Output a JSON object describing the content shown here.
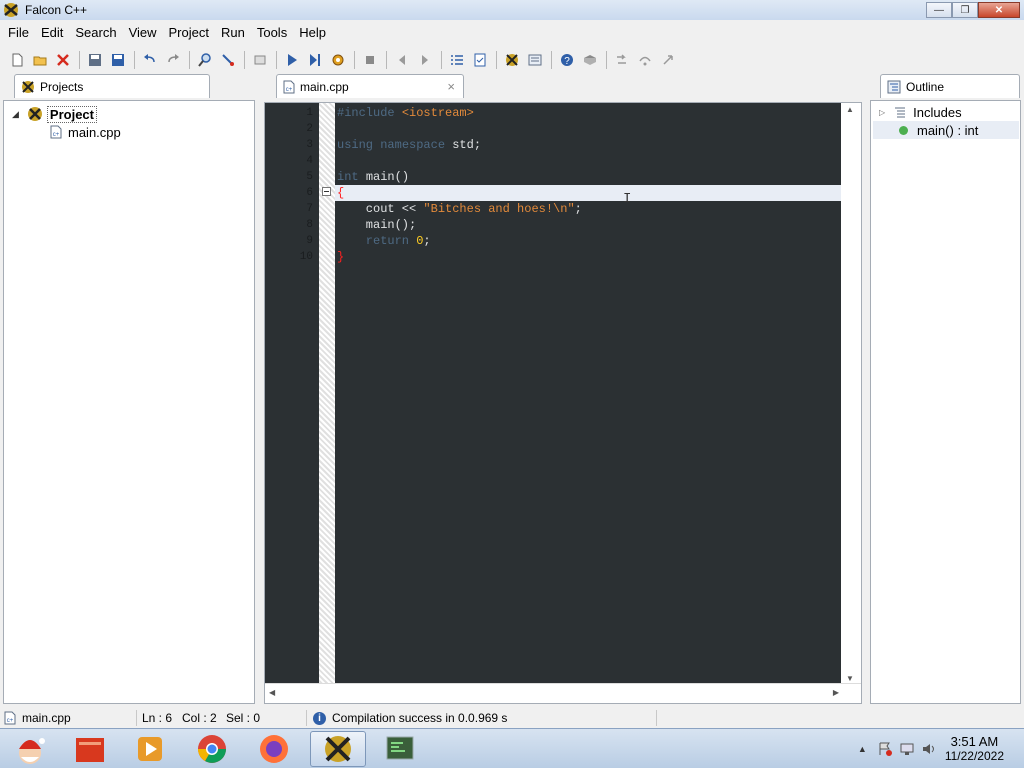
{
  "window": {
    "title": "Falcon C++"
  },
  "menu": [
    "File",
    "Edit",
    "Search",
    "View",
    "Project",
    "Run",
    "Tools",
    "Help"
  ],
  "toolbar": {
    "buttons": [
      "new-file",
      "open",
      "close",
      "save",
      "save-all",
      "undo",
      "redo",
      "find",
      "replace",
      "toggle-comment",
      "run",
      "build-run",
      "compile",
      "stop",
      "prev",
      "next",
      "list",
      "properties",
      "falcon",
      "packages",
      "help",
      "book",
      "step-into",
      "step-over",
      "step-out"
    ]
  },
  "projects_panel": {
    "tab_label": "Projects",
    "root": "Project",
    "files": [
      "main.cpp"
    ]
  },
  "editor": {
    "tab_label": "main.cpp",
    "close_glyph": "×",
    "line_numbers": [
      "1",
      "2",
      "3",
      "4",
      "5",
      "6",
      "7",
      "8",
      "9",
      "10"
    ],
    "lines": [
      {
        "parts": [
          {
            "t": "#include ",
            "c": "kw"
          },
          {
            "t": "<iostream>",
            "c": "str"
          }
        ]
      },
      {
        "parts": []
      },
      {
        "parts": [
          {
            "t": "using ",
            "c": "kw"
          },
          {
            "t": "namespace ",
            "c": "kw"
          },
          {
            "t": "std;",
            "c": ""
          }
        ]
      },
      {
        "parts": []
      },
      {
        "parts": [
          {
            "t": "int ",
            "c": "kw"
          },
          {
            "t": "main()",
            "c": ""
          }
        ]
      },
      {
        "parts": [
          {
            "t": "{",
            "c": "brace-red"
          }
        ]
      },
      {
        "parts": [
          {
            "t": "    cout << ",
            "c": ""
          },
          {
            "t": "\"Bitches and hoes!\\n\"",
            "c": "str"
          },
          {
            "t": ";",
            "c": ""
          }
        ]
      },
      {
        "parts": [
          {
            "t": "    main();",
            "c": ""
          }
        ]
      },
      {
        "parts": [
          {
            "t": "    return ",
            "c": "kw"
          },
          {
            "t": "0",
            "c": "num"
          },
          {
            "t": ";",
            "c": ""
          }
        ]
      },
      {
        "parts": [
          {
            "t": "}",
            "c": "brace-red"
          }
        ]
      }
    ]
  },
  "outline_panel": {
    "tab_label": "Outline",
    "items": [
      {
        "label": "Includes"
      },
      {
        "label": "main() : int"
      }
    ]
  },
  "statusbar": {
    "file": "main.cpp",
    "ln": "Ln : 6",
    "col": "Col : 2",
    "sel": "Sel : 0",
    "message": "Compilation success in 0.0.969 s"
  },
  "taskbar": {
    "apps": [
      "santa",
      "files",
      "media-player",
      "chrome",
      "firefox",
      "falcon-cpp",
      "terminal"
    ],
    "time": "3:51 AM",
    "date": "11/22/2022"
  }
}
